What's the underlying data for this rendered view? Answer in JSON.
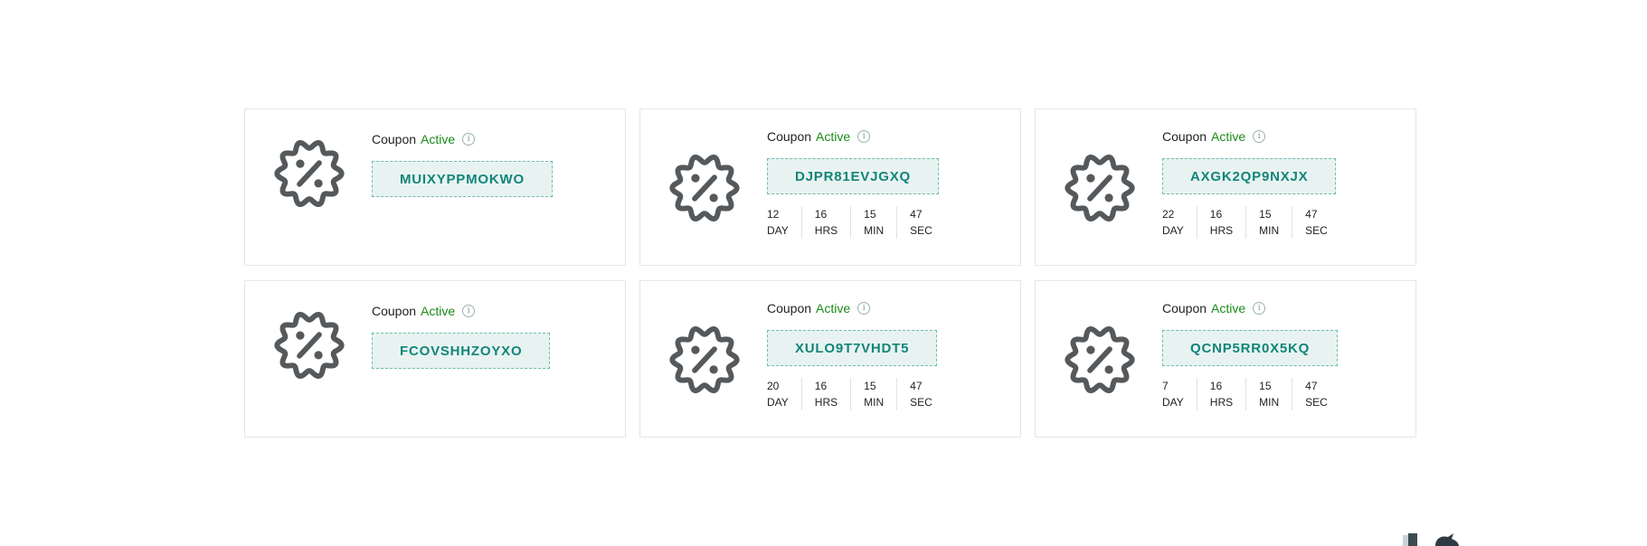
{
  "coupons": [
    {
      "label": "Coupon",
      "status": "Active",
      "info_icon": "info-icon",
      "code": "MUIXYPPMOKWO",
      "countdown": null
    },
    {
      "label": "Coupon",
      "status": "Active",
      "info_icon": "info-icon",
      "code": "DJPR81EVJGXQ",
      "countdown": {
        "day": "12",
        "hrs": "16",
        "min": "15",
        "sec": "47"
      }
    },
    {
      "label": "Coupon",
      "status": "Active",
      "info_icon": "info-icon",
      "code": "AXGK2QP9NXJX",
      "countdown": {
        "day": "22",
        "hrs": "16",
        "min": "15",
        "sec": "47"
      }
    },
    {
      "label": "Coupon",
      "status": "Active",
      "info_icon": "info-icon",
      "code": "FCOVSHHZOYXO",
      "countdown": null
    },
    {
      "label": "Coupon",
      "status": "Active",
      "info_icon": "info-icon",
      "code": "XULO9T7VHDT5",
      "countdown": {
        "day": "20",
        "hrs": "16",
        "min": "15",
        "sec": "47"
      }
    },
    {
      "label": "Coupon",
      "status": "Active",
      "info_icon": "info-icon",
      "code": "QCNP5RR0X5KQ",
      "countdown": {
        "day": "7",
        "hrs": "16",
        "min": "15",
        "sec": "47"
      }
    }
  ],
  "countdown_labels": {
    "day": "DAY",
    "hrs": "HRS",
    "min": "MIN",
    "sec": "SEC"
  },
  "colors": {
    "active_status": "#1a8a1a",
    "code_text": "#12857a",
    "code_bg": "#e8f3f1",
    "code_border": "#6cbcb0",
    "badge_icon": "#55595c",
    "card_border": "#e6e6e6"
  },
  "icons": {
    "badge": "discount-percent-badge-icon",
    "info": "info-icon"
  }
}
